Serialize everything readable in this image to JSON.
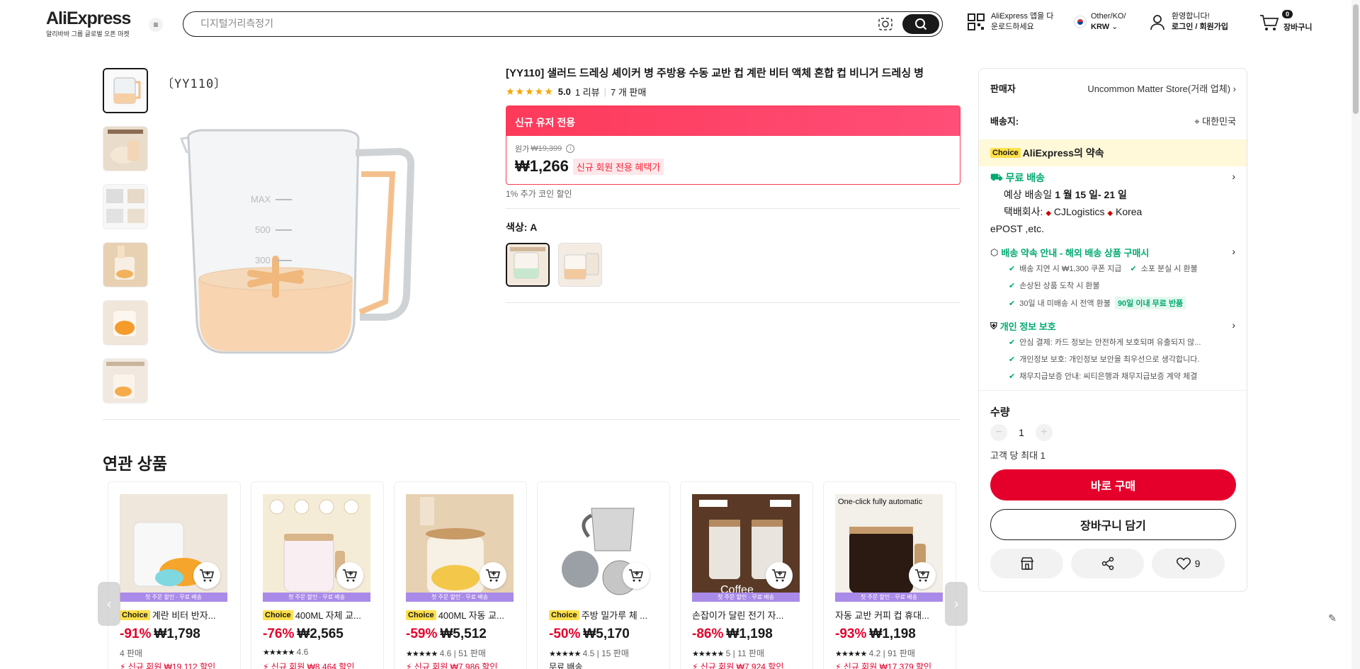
{
  "header": {
    "logo": "AliExpress",
    "logo_sub": "알리바바 그룹 글로벌 오픈 마켓",
    "search_placeholder": "디지털거리측정기",
    "app_line1": "AliExpress 앱을 다",
    "app_line2": "운로드하세요",
    "locale_line1": "Other/KO/",
    "locale_line2": "KRW",
    "user_line1": "환영합니다!",
    "user_line2": "로그인 / 회원가입",
    "cart_count": "0",
    "cart_label": "장바구니"
  },
  "gallery": {
    "code_label": "〔YY110〕"
  },
  "product": {
    "title": "[YY110] 샐러드 드레싱 셰이커 병 주방용 수동 교반 컵 계란 비터 액체 혼합 컵 비니거 드레싱 병",
    "stars": "★★★★★",
    "rating": "5.0",
    "reviews": "1 리뷰",
    "sold": "7 개 판매",
    "promo_header": "신규 유저 전용",
    "orig_label": "원가",
    "orig_price": "₩19,399",
    "price": "₩1,266",
    "price_tag": "신규 회원 전용 혜택가",
    "coin_discount": "1% 추가 코인 할인",
    "color_label": "색상: A"
  },
  "related": {
    "title": "연관 상품",
    "strip": "첫 주문 할인 · 무료 배송",
    "items": [
      {
        "choice": "Choice",
        "name": "계란 비터 반자...",
        "disc": "-91%",
        "price": "₩1,798",
        "meta": "4 판매",
        "stars": "",
        "promo": "신규 회원 ₩19,112 할인"
      },
      {
        "choice": "Choice",
        "name": "400ML 자체 교...",
        "disc": "-76%",
        "price": "₩2,565",
        "meta": "4.6",
        "stars": "★★★★★",
        "promo": "신규 회원 ₩8,464 할인"
      },
      {
        "choice": "Choice",
        "name": "400ML 자동 교...",
        "disc": "-59%",
        "price": "₩5,512",
        "meta": "4.6 | 51 판매",
        "stars": "★★★★★",
        "promo": "신규 회원 ₩7,986 할인"
      },
      {
        "choice": "Choice",
        "name": "주방 밀가루 체 ...",
        "disc": "-50%",
        "price": "₩5,170",
        "meta": "4.5 | 15 판매",
        "stars": "★★★★★",
        "promo": "무료 배송"
      },
      {
        "choice": "",
        "name": "손잡이가 달린 전기 자...",
        "disc": "-86%",
        "price": "₩1,198",
        "meta": "5 | 11 판매",
        "stars": "★★★★★",
        "promo": "신규 회원 ₩7,924 할인"
      },
      {
        "choice": "",
        "name": "자동 교반 커피 컵 휴대...",
        "disc": "-93%",
        "price": "₩1,198",
        "meta": "4.2 | 91 판매",
        "stars": "★★★★★",
        "promo": "신규 회원 ₩17,379 할인"
      }
    ]
  },
  "panel": {
    "seller_label": "판매자",
    "seller_value": "Uncommon Matter Store(거래 업체)",
    "ship_to_label": "배송지:",
    "ship_to_value": "대한민국",
    "choice_badge": "Choice",
    "choice_text": "AliExpress의 약속",
    "free_ship": "무료 배송",
    "delivery_prefix": "예상 배송일",
    "delivery_dates": "1 월 15 일- 21 일",
    "carrier_line1": "택배회사:",
    "carrier_name": "CJLogistics",
    "carrier_name2": "Korea",
    "carrier_line2": "ePOST ,etc.",
    "promise_title": "배송 약속 안내 - 해외 배송 상품 구매시",
    "promise_1": "배송 지연 시 ₩1,300 쿠폰 지급",
    "promise_2": "소포 분실 시 환불",
    "promise_3": "손상된 상품 도착 시 환불",
    "promise_4": "30일 내 미배송 시 전액 환불",
    "free_return": "90일 이내 무료 반품",
    "privacy_title": "개인 정보 보호",
    "privacy_1": "안심 결제: 카드 정보는 안전하게 보호되며 유출되지 않...",
    "privacy_2": "개인정보 보호: 개인정보 보안을 최우선으로 생각합니다.",
    "privacy_3": "채무지급보증 안내: 씨티은행과 채무지급보증 계약 체결",
    "qty_label": "수량",
    "qty_value": "1",
    "limit": "고객 당 최대 1",
    "buy_now": "바로 구매",
    "add_cart": "장바구니 담기",
    "wish_count": "9"
  }
}
